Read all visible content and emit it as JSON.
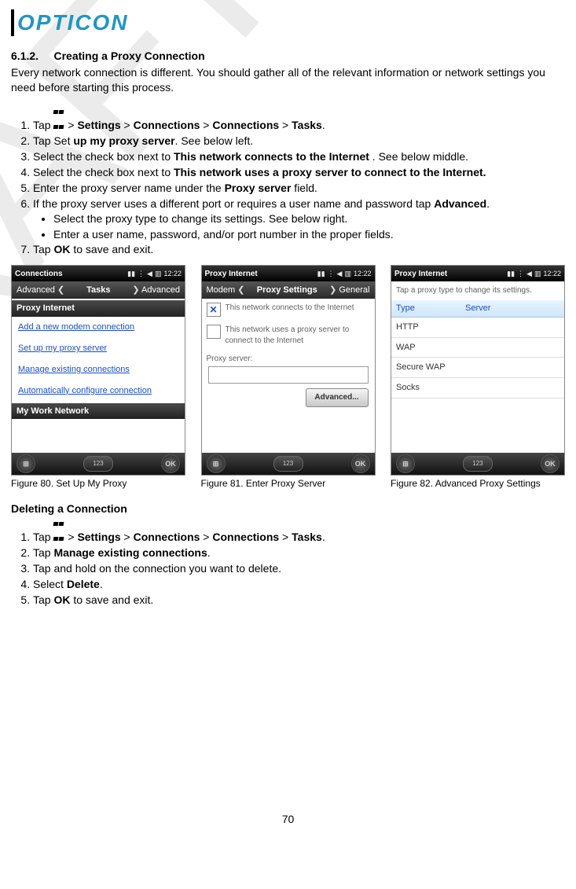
{
  "logo": "OPTICON",
  "section_number": "6.1.2.",
  "section_title": "Creating a Proxy Connection",
  "intro": "Every network connection is different. You should gather all of the relevant information or network settings you need before starting this process.",
  "steps1": {
    "s1_pre": "Tap",
    "s1_path": [
      "Settings",
      "Connections",
      "Connections",
      "Tasks"
    ],
    "s2_pre": "Tap Set",
    "s2_bold": "up my proxy server",
    "s2_post": ". See below left.",
    "s3_pre": "Select the check box next to ",
    "s3_bold": "This network connects to the Internet",
    "s3_post": " . See below middle.",
    "s4_pre": "Select the check box next to ",
    "s4_bold": "This network uses a proxy server to connect to the Internet.",
    "s5_pre": "Enter the proxy server name under the ",
    "s5_bold": "Proxy server",
    "s5_post": " field.",
    "s6_pre": "If the proxy server uses a different port or requires a user name and password tap ",
    "s6_bold": "Advanced",
    "s6_post": ".",
    "s6a": "Select the proxy type to change its settings. See below right.",
    "s6b": "Enter a user name, password, and/or port number in the proper fields.",
    "s7_pre": "Tap ",
    "s7_bold": "OK",
    "s7_post": " to save and exit."
  },
  "captions": {
    "c1": "Figure 80. Set Up My Proxy",
    "c2": "Figure 81. Enter Proxy Server",
    "c3": "Figure 82. Advanced Proxy Settings"
  },
  "screens": {
    "time": "12:22",
    "s1": {
      "title": "Connections",
      "nav_left": "Advanced",
      "nav_mid": "Tasks",
      "nav_right": "Advanced",
      "hdr1": "Proxy Internet",
      "links": [
        "Add a new modem connection",
        "Set up my proxy server",
        "Manage existing connections",
        "Automatically configure connection"
      ],
      "hdr2": "My Work Network"
    },
    "s2": {
      "title": "Proxy Internet",
      "nav_left": "Modem",
      "nav_mid": "Proxy Settings",
      "nav_right": "General",
      "chk1": "This network connects to the Internet",
      "chk2": "This network uses a proxy server to connect to the Internet",
      "lbl": "Proxy server:",
      "btn": "Advanced..."
    },
    "s3": {
      "title": "Proxy Internet",
      "hint": "Tap a proxy type to change its settings.",
      "col1": "Type",
      "col2": "Server",
      "rows": [
        "HTTP",
        "WAP",
        "Secure WAP",
        "Socks"
      ]
    },
    "ok": "OK",
    "kbd": "123"
  },
  "subhead2": "Deleting a Connection",
  "steps2": {
    "s1_pre": "Tap",
    "s1_path": [
      "Settings",
      "Connections",
      "Connections",
      "Tasks"
    ],
    "s2_pre": "Tap ",
    "s2_bold": "Manage existing connections",
    "s2_post": ".",
    "s3": "Tap and hold on the connection you want to delete.",
    "s4_pre": "Select ",
    "s4_bold": "Delete",
    "s4_post": ".",
    "s5_pre": "Tap ",
    "s5_bold": "OK",
    "s5_post": " to save and exit."
  },
  "page_number": "70",
  "watermark": "DRAFT"
}
